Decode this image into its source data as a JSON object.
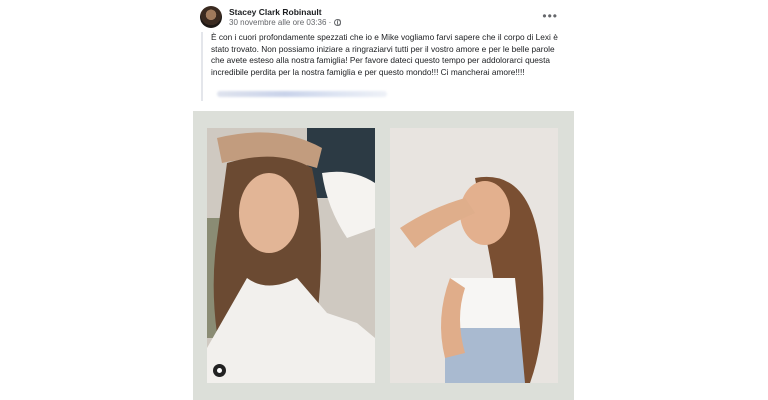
{
  "post": {
    "author": "Stacey Clark Robinault",
    "timestamp": "30 novembre alle ore 03:36 ·",
    "privacy_icon": "globe-icon",
    "more_icon": "more-options-icon",
    "text": "È con i cuori profondamente spezzati che io e Mike vogliamo farvi sapere che il corpo di Lexi è stato trovato. Non possiamo iniziare a ringraziarvi tutti per il vostro amore e per le belle parole che avete esteso alla nostra famiglia! Per favore dateci questo tempo per addolorarci questa incredibile perdita per la nostra famiglia e per questo mondo!!! Ci mancherai amore!!!!"
  },
  "colors": {
    "frame": "#dcdfd9",
    "author_text": "#1c1e21",
    "meta_text": "#65676b"
  }
}
